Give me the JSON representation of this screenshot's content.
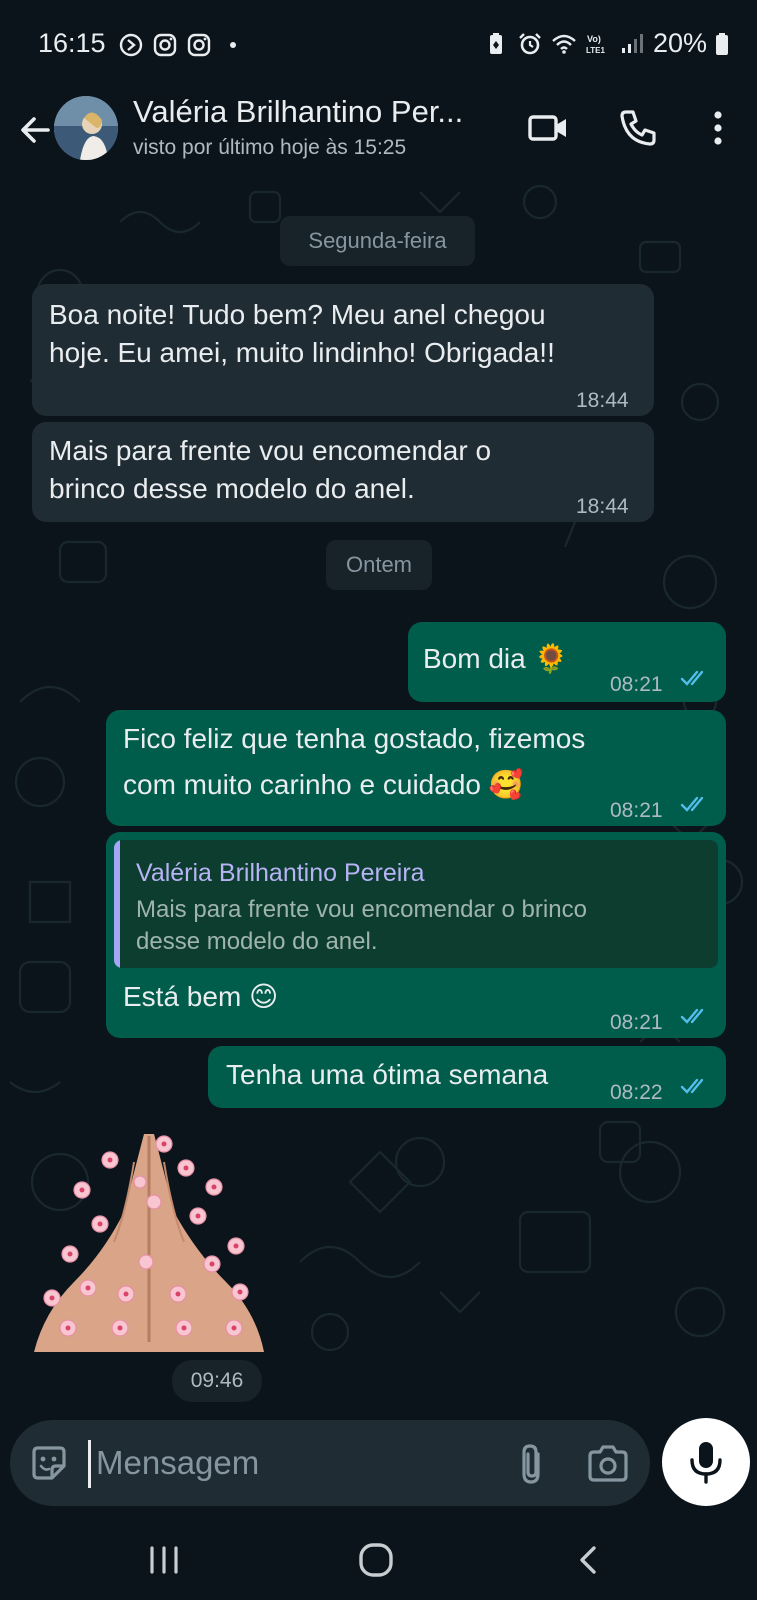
{
  "status_bar": {
    "time": "16:15",
    "battery": "20%",
    "left_icons": [
      "clock-app-icon",
      "instagram-icon",
      "instagram-icon",
      "dot-icon"
    ],
    "right_icons": [
      "battery-saver-icon",
      "alarm-icon",
      "wifi-icon",
      "volte-icon",
      "signal-icon",
      "battery-icon"
    ]
  },
  "header": {
    "contact_name": "Valéria Brilhantino Per...",
    "last_seen": "visto por último hoje às 15:25",
    "icons": [
      "back-arrow-icon",
      "video-call-icon",
      "phone-icon",
      "more-options-icon"
    ]
  },
  "chat": {
    "day_separators": [
      "Segunda-feira",
      "Ontem"
    ],
    "messages": [
      {
        "direction": "incoming",
        "lines": [
          "Boa noite! Tudo bem? Meu anel chegou",
          "hoje. Eu amei, muito lindinho! Obrigada!!"
        ],
        "time": "18:44"
      },
      {
        "direction": "incoming",
        "lines": [
          "Mais para frente vou encomendar o",
          "brinco desse modelo do anel."
        ],
        "time": "18:44"
      },
      {
        "direction": "outgoing",
        "lines": [
          "Bom dia 🌻"
        ],
        "time": "08:21",
        "status": "read"
      },
      {
        "direction": "outgoing",
        "lines": [
          "Fico feliz que tenha gostado, fizemos",
          "com muito carinho e cuidado 🥰"
        ],
        "time": "08:21",
        "status": "read"
      },
      {
        "direction": "outgoing",
        "quote": {
          "author": "Valéria Brilhantino Pereira",
          "lines": [
            "Mais para frente vou encomendar o brinco",
            "desse modelo do anel."
          ]
        },
        "lines": [
          "Está bem 😊"
        ],
        "time": "08:21",
        "status": "read"
      },
      {
        "direction": "outgoing",
        "lines": [
          "Tenha uma ótima semana"
        ],
        "time": "08:22",
        "status": "read"
      }
    ],
    "sticker": {
      "description_icon": "praying-hands-sticker",
      "time": "09:46"
    }
  },
  "input": {
    "placeholder": "Mensagem",
    "icons": [
      "sticker-emoji-icon",
      "attach-clip-icon",
      "camera-icon",
      "mic-icon"
    ]
  },
  "colors": {
    "background": "#0b141a",
    "incoming_bubble": "#202c33",
    "outgoing_bubble": "#005c4b",
    "read_ticks": "#53bdeb",
    "quote_bar": "#a5a6f6"
  },
  "nav_bar": {
    "icons": [
      "recents-icon",
      "home-icon",
      "back-icon"
    ]
  }
}
